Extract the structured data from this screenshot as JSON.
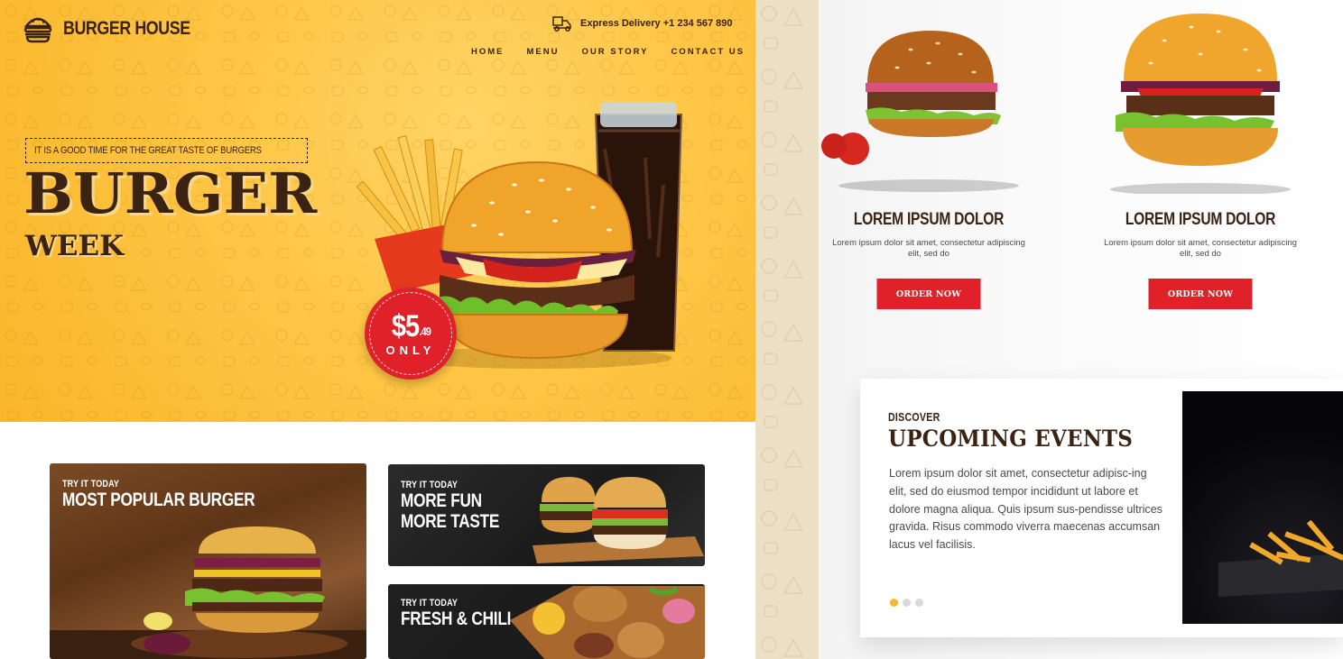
{
  "brand": {
    "name": "BURGER HOUSE"
  },
  "header": {
    "delivery_text": "Express Delivery +1 234 567 890",
    "nav": [
      "HOME",
      "MENU",
      "OUR STORY",
      "CONTACT US"
    ]
  },
  "hero": {
    "tagline": "IT IS A GOOD TIME FOR THE GREAT TASTE OF BURGERS",
    "title": "BURGER",
    "subtitle": "WEEK",
    "price_main": "$5",
    "price_cents": ".49",
    "price_note": "ONLY"
  },
  "promos": [
    {
      "kicker": "TRY IT TODAY",
      "lines": [
        "MOST POPULAR BURGER"
      ]
    },
    {
      "kicker": "TRY IT TODAY",
      "lines": [
        "MORE FUN",
        "MORE TASTE"
      ]
    },
    {
      "kicker": "TRY IT TODAY",
      "lines": [
        "FRESH & CHILI"
      ]
    }
  ],
  "products": [
    {
      "title": "LOREM IPSUM DOLOR",
      "desc": "Lorem ipsum dolor sit amet, consectetur adipiscing elit, sed do",
      "button": "ORDER NOW"
    },
    {
      "title": "LOREM IPSUM DOLOR",
      "desc": "Lorem ipsum dolor sit amet, consectetur adipiscing elit, sed do",
      "button": "ORDER NOW"
    }
  ],
  "events": {
    "kicker": "DISCOVER",
    "title": "UPCOMING EVENTS",
    "body": "Lorem ipsum dolor sit amet, consectetur adipisc-ing elit, sed do eiusmod tempor incididunt ut labore et dolore magna aliqua. Quis ipsum sus-pendisse ultrices gravida. Risus commodo viverra maecenas accumsan lacus vel facilisis.",
    "slides": 3,
    "active_slide": 1
  },
  "colors": {
    "primary_yellow": "#fec544",
    "brown": "#3b2314",
    "red": "#e0212a",
    "dot_active": "#f5b82e"
  }
}
